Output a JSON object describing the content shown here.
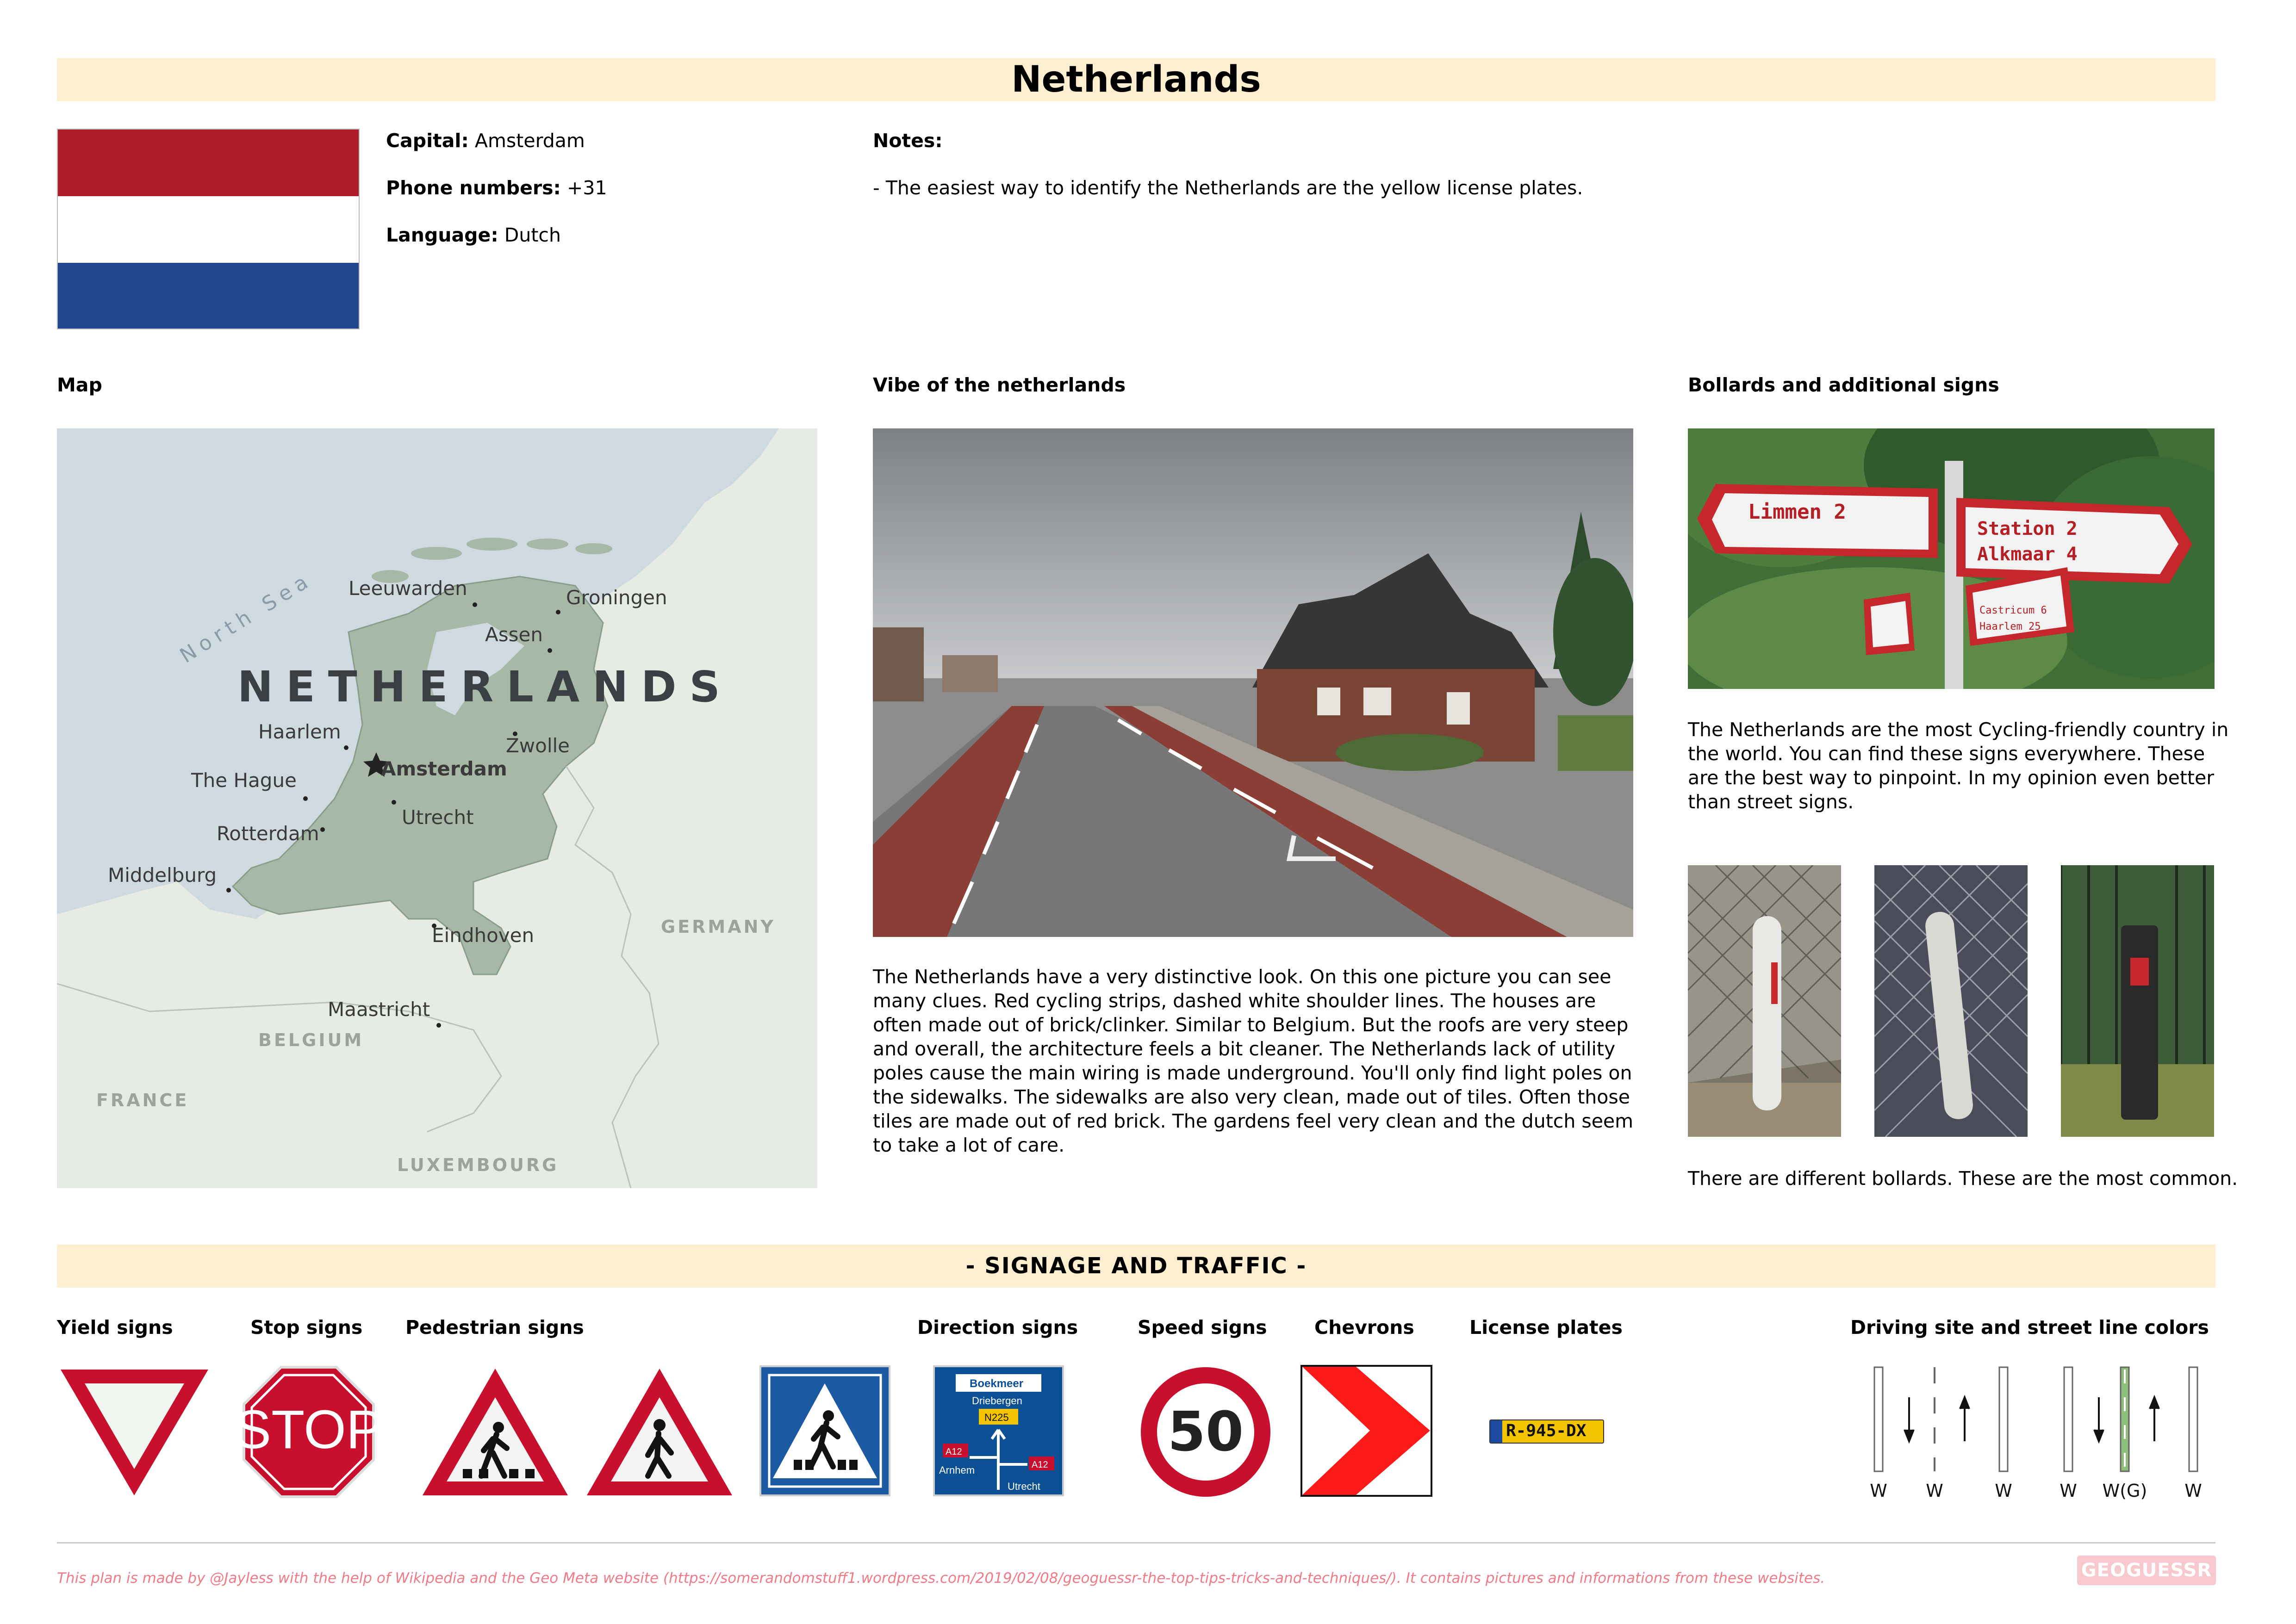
{
  "title": "Netherlands",
  "info": {
    "capital_label": "Capital:",
    "capital_value": "Amsterdam",
    "phone_label": "Phone numbers:",
    "phone_value": "+31",
    "language_label": "Language:",
    "language_value": "Dutch"
  },
  "notes": {
    "heading": "Notes:",
    "text": "- The easiest way to identify the Netherlands are the yellow license plates."
  },
  "flag_colors": [
    "#ae1c28",
    "#ffffff",
    "#21468b"
  ],
  "map": {
    "heading": "Map",
    "country_label": "NETHERLANDS",
    "sea_label": "North Sea",
    "cities": [
      "Leeuwarden",
      "Groningen",
      "Assen",
      "Haarlem",
      "Amsterdam",
      "Zwolle",
      "The Hague",
      "Utrecht",
      "Rotterdam",
      "Middelburg",
      "Eindhoven",
      "Maastricht"
    ],
    "neighbors": [
      "GERMANY",
      "BELGIUM",
      "FRANCE",
      "LUXEMBOURG"
    ]
  },
  "vibe": {
    "heading": "Vibe of the netherlands",
    "text": "The Netherlands have a very distinctive look. On this one picture you can see many clues. Red cycling strips, dashed white shoulder lines. The houses are often made out of brick/clinker. Similar to Belgium. But the roofs are very steep and overall, the architecture feels a bit cleaner. The Netherlands lack of utility poles cause the main wiring is made underground. You'll only find light poles on the sidewalks. The sidewalks are also very clean, made out of tiles. Often those tiles are made out of red brick. The gardens feel very clean and the dutch seem to take a lot of care."
  },
  "bollards": {
    "heading": "Bollards and additional signs",
    "sign_texts": [
      "Limmen 2",
      "Station 2",
      "Alkmaar 4",
      "Castricum 6",
      "Haarlem 25"
    ],
    "text": "The Netherlands are the most Cycling-friendly country in the world. You can find these signs everywhere. These are the best way to pinpoint. In my opinion even better than street signs.",
    "caption": "There are different bollards. These are the most common."
  },
  "signage": {
    "heading": "- SIGNAGE AND TRAFFIC -",
    "yield": "Yield signs",
    "stop": "Stop signs",
    "stop_text": "STOP",
    "pedestrian": "Pedestrian signs",
    "direction": "Direction signs",
    "direction_texts": [
      "Boekmeer",
      "Driebergen",
      "N225",
      "A12",
      "Arnhem",
      "A12",
      "Utrecht"
    ],
    "speed": "Speed signs",
    "speed_value": "50",
    "chevrons": "Chevrons",
    "plates": "License plates",
    "plate_text": "R-945-DX",
    "driving": "Driving site and street line colors",
    "line_labels_a": [
      "W",
      "W",
      "W"
    ],
    "line_labels_b": [
      "W",
      "W(G)",
      "W"
    ]
  },
  "footer": {
    "text": "This plan is made by @Jayless with the help of Wikipedia and the Geo Meta website (https://somerandomstuff1.wordpress.com/2019/02/08/geoguessr-the-top-tips-tricks-and-techniques/). It contains pictures and informations from these websites.",
    "logo": "GEOGUESSR"
  },
  "colors": {
    "band": "#fdefd0",
    "sign_red": "#c8102e",
    "nl_blue": "#21468b",
    "plate_yellow": "#f5c400",
    "footer": "#f07a88"
  }
}
